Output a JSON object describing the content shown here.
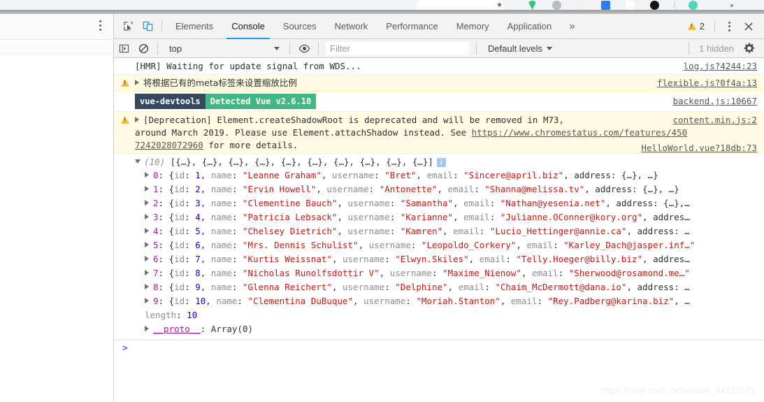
{
  "browser": {
    "star_icon": "star-icon",
    "extension_icons": [
      "ext-green-icon",
      "ext-gray-icon",
      "ext-white-icon",
      "ext-blue-icon",
      "ext-glasses-icon",
      "ext-black-icon",
      "ext-teal-icon",
      "ext-dot-icon"
    ]
  },
  "devtools": {
    "inspect_icon": "inspect-element-icon",
    "device_icon": "toggle-device-toolbar-icon",
    "tabs": [
      {
        "label": "Elements",
        "active": false
      },
      {
        "label": "Console",
        "active": true
      },
      {
        "label": "Sources",
        "active": false
      },
      {
        "label": "Network",
        "active": false
      },
      {
        "label": "Performance",
        "active": false
      },
      {
        "label": "Memory",
        "active": false
      },
      {
        "label": "Application",
        "active": false
      }
    ],
    "more_tabs_label": "»",
    "warning_count": "2",
    "kebab_icon": "more-options-icon",
    "close_icon": "close-icon"
  },
  "filterbar": {
    "sidebar_toggle_icon": "console-sidebar-icon",
    "clear_icon": "clear-console-icon",
    "context": "top",
    "eye_icon": "live-expression-icon",
    "filter_value": "",
    "filter_placeholder": "Filter",
    "levels": "Default levels",
    "hidden_label": "1 hidden",
    "settings_icon": "settings-gear-icon"
  },
  "messages": [
    {
      "id": "hmr",
      "level": "log",
      "text": "[HMR] Waiting for update signal from WDS...",
      "source": "log.js?4244:23",
      "expandable": false
    },
    {
      "id": "flexible-warning",
      "level": "warning",
      "text": "将根据已有的meta标签来设置缩放比例",
      "source": "flexible.js?0f4a:13",
      "expandable": true
    },
    {
      "id": "vue-devtools",
      "level": "log",
      "badge_left": "vue-devtools",
      "badge_right": "Detected Vue v2.6.10",
      "source": "backend.js:10667",
      "expandable": false
    },
    {
      "id": "deprecation",
      "level": "warning",
      "line1": "[Deprecation] Element.createShadowRoot is deprecated and will be removed in M73,",
      "line2_a": "around March 2019. Please use Element.attachShadow instead. See ",
      "line2_link": "https://www.chromestatus.com/features/450",
      "line3_link": "7242028072960",
      "line3_b": " for more details.",
      "source": "content.min.js:2",
      "expandable": true
    }
  ],
  "object_dump": {
    "source": "HelloWorld.vue?18db:73",
    "header_count": "(10)",
    "header_preview": "[{…}, {…}, {…}, {…}, {…}, {…}, {…}, {…}, {…}, {…}]",
    "info_icon": "info-icon",
    "rows": [
      {
        "index": "0",
        "id": "1",
        "name": "Leanne Graham",
        "username": "Bret",
        "email": "Sincere@april.biz",
        "tail": ", address: {…}, …}"
      },
      {
        "index": "1",
        "id": "2",
        "name": "Ervin Howell",
        "username": "Antonette",
        "email": "Shanna@melissa.tv",
        "tail": ", address: {…}, …}"
      },
      {
        "index": "2",
        "id": "3",
        "name": "Clementine Bauch",
        "username": "Samantha",
        "email": "Nathan@yesenia.net",
        "tail": ", address: {…},…"
      },
      {
        "index": "3",
        "id": "4",
        "name": "Patricia Lebsack",
        "username": "Karianne",
        "email": "Julianne.OConner@kory.org",
        "tail": ", addres…"
      },
      {
        "index": "4",
        "id": "5",
        "name": "Chelsey Dietrich",
        "username": "Kamren",
        "email": "Lucio_Hettinger@annie.ca",
        "tail": ", address: …"
      },
      {
        "index": "5",
        "id": "6",
        "name": "Mrs. Dennis Schulist",
        "username": "Leopoldo_Corkery",
        "email": "Karley_Dach@jasper.inf…",
        "tail": ""
      },
      {
        "index": "6",
        "id": "7",
        "name": "Kurtis Weissnat",
        "username": "Elwyn.Skiles",
        "email": "Telly.Hoeger@billy.biz",
        "tail": ", addres…"
      },
      {
        "index": "7",
        "id": "8",
        "name": "Nicholas Runolfsdottir V",
        "username": "Maxime_Nienow",
        "email": "Sherwood@rosamond.me…",
        "tail": ""
      },
      {
        "index": "8",
        "id": "9",
        "name": "Glenna Reichert",
        "username": "Delphine",
        "email": "Chaim_McDermott@dana.io",
        "tail": ", address: …"
      },
      {
        "index": "9",
        "id": "10",
        "name": "Clementina DuBuque",
        "username": "Moriah.Stanton",
        "email": "Rey.Padberg@karina.biz",
        "tail": ", …"
      }
    ],
    "length_key": "length",
    "length_value": "10",
    "proto_key": "__proto__",
    "proto_value": "Array(0)"
  },
  "prompt": {
    "caret": ">",
    "value": ""
  },
  "watermark": "https://blog.csdn.net/weixin_44128575",
  "colors": {
    "accent": "#1a9af7",
    "warning_bg": "#fffbe5",
    "warning_icon": "#f5bc42",
    "string": "#c41a16",
    "number": "#1c00cf",
    "property": "#8d8d8d",
    "index": "#a020a0",
    "vue_dark": "#35495e",
    "vue_green": "#41b883"
  }
}
